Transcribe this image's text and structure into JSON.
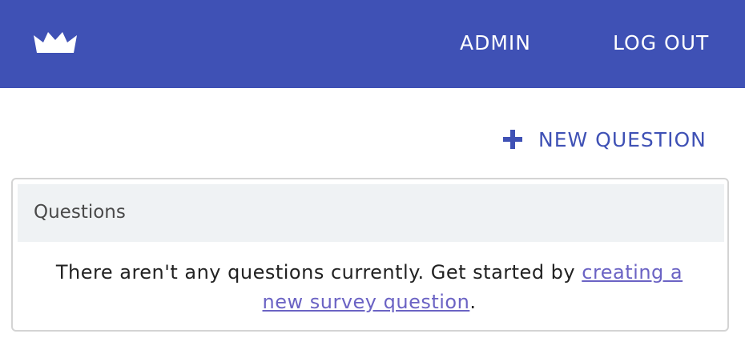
{
  "header": {
    "logo_icon": "crown-icon",
    "nav": {
      "admin_label": "ADMIN",
      "logout_label": "LOG OUT"
    },
    "background_color": "#3f51b5"
  },
  "toolbar": {
    "new_question_icon": "plus-icon",
    "new_question_label": "NEW QUESTION"
  },
  "questions_panel": {
    "title": "Questions",
    "empty_text_before": "There aren't any questions currently. Get started by ",
    "empty_link_label": "creating a new survey question",
    "empty_text_after": "."
  },
  "colors": {
    "accent": "#3f51b5",
    "link": "#6b63c4",
    "panel_header_bg": "#eff2f4"
  }
}
